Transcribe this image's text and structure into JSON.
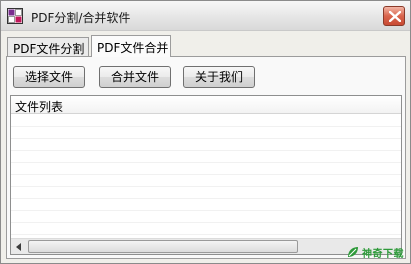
{
  "window": {
    "title": "PDF分割/合并软件",
    "app_icon": "grid-app-icon",
    "close_icon": "close-icon"
  },
  "tabs": [
    {
      "label": "PDF文件分割",
      "selected": false
    },
    {
      "label": "PDF文件合并",
      "selected": true
    }
  ],
  "toolbar": {
    "select_files_label": "选择文件",
    "merge_files_label": "合并文件",
    "about_label": "关于我们"
  },
  "file_list": {
    "columns": [
      "文件列表"
    ],
    "rows": []
  },
  "watermark": {
    "text": "神奇下载",
    "icon": "leaf-logo-icon"
  },
  "colors": {
    "close_button": "#d9644c",
    "watermark_green": "#2e9a3a"
  }
}
